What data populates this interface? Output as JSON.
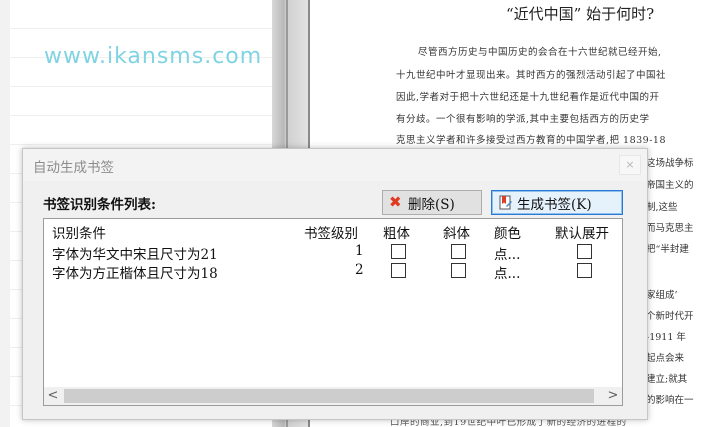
{
  "background": {
    "watermark": "www.ikansms.com",
    "doc_title": "“近代中国” 始于何时?",
    "doc_lines": [
      "尽管西方历史与中国历史的会合在十六世纪就已经开始,",
      "十九世纪中叶才显现出来。其时西方的强烈活动引起了中国社",
      "因此,学者对于把十六世纪还是十九世纪看作是近代中国的开",
      "有分歧。一个很有影响的学派,其中主要包括西方的历史学",
      "克思主义学者和许多接受过西方教育的中国学者,把 1839-18"
    ],
    "doc_fragments": [
      "这场战争标",
      "帝国主义的",
      "制,这些",
      "而马克思主",
      "把“半封建",
      "家组成’",
      "个新时代开",
      "-1911 年",
      "起点会来",
      "建立;就其",
      "的影响在一"
    ],
    "doc_bottom_line": "口岸的商业,到19世纪中叶已形成了新的经济的进程的"
  },
  "dialog": {
    "title": "自动生成书签",
    "close_label": "×",
    "list_label": "书签识别条件列表:",
    "delete_button": "删除(S)",
    "generate_button": "生成书签(K)",
    "table": {
      "headers": {
        "condition": "识别条件",
        "level": "书签级别",
        "bold": "粗体",
        "italic": "斜体",
        "color": "颜色",
        "expand": "默认展开"
      },
      "rows": [
        {
          "condition": "字体为华文中宋且尺寸为21",
          "level": "1",
          "bold": false,
          "italic": false,
          "color": "点...",
          "expand": false
        },
        {
          "condition": "字体为方正楷体且尺寸为18",
          "level": "2",
          "bold": false,
          "italic": false,
          "color": "点...",
          "expand": false
        }
      ]
    },
    "scroll_left": "<",
    "scroll_right": ">"
  }
}
